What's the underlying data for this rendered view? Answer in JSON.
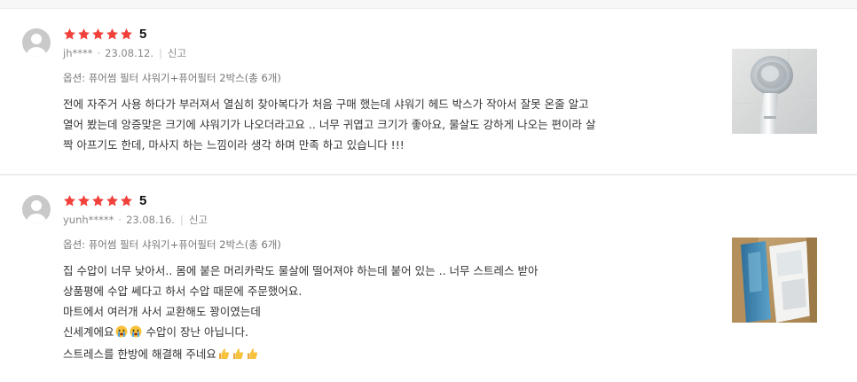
{
  "reviews": [
    {
      "rating": "5",
      "rating_value": 5,
      "rating_max": 5,
      "user": "jh****",
      "date": "23.08.12.",
      "report_label": "신고",
      "option": "옵션: 퓨어썸 필터 샤워기+퓨어필터 2박스(총 6개)",
      "lines": [
        "전에 자주거 사용 하다가 부러져서 열심히 찾아복다가 처음 구매 했는데 샤워기 헤드 박스가 작아서 잘못 온줄 알고",
        "열어 봤는데 앙증맞은 크기에 샤워기가 나오더라고요 .. 너무 귀엽고 크기가 좋아요, 물살도 강하게 나오는 편이라 살",
        "짝 아프기도 한데, 마사지 하는 느낌이라 생각 하며 만족 하고 있습니다 !!!"
      ],
      "photo_icon": "shower-head-photo"
    },
    {
      "rating": "5",
      "rating_value": 5,
      "rating_max": 5,
      "user": "yunh*****",
      "date": "23.08.16.",
      "report_label": "신고",
      "option": "옵션: 퓨어썸 필터 샤워기+퓨어필터 2박스(총 6개)",
      "lines": [
        "집 수압이 너무 낮아서.. 몸에 붙은 머리카락도 물살에 떨어져야 하는데 붙어 있는 .. 너무 스트레스 받아",
        "상품평에 수압 쎄다고 하서 수압 때문에 주문했어요.",
        "마트에서 여러개 사서 교환해도 꽝이였는데",
        "신세계에요",
        "수압이 장난 아닙니다.",
        "스트레스를 한방에 해결해 주네요"
      ],
      "photo_icon": "product-box-photo"
    }
  ],
  "colors": {
    "star": "#f1403a",
    "avatar": "#c9c9c9",
    "meta": "#888888",
    "text": "#333333"
  },
  "icons": {
    "star": "star-icon",
    "avatar": "user-avatar-icon",
    "crying": "crying-face-emoji",
    "thumbs_up": "thumbs-up-emoji"
  }
}
